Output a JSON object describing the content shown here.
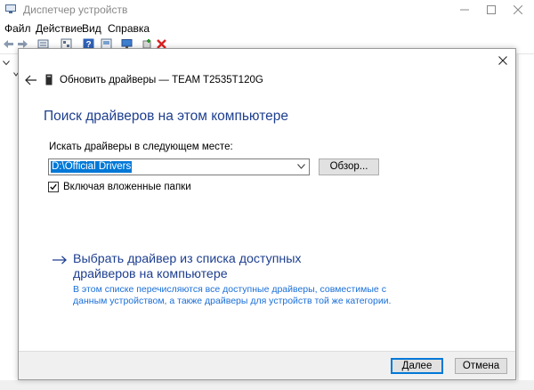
{
  "app": {
    "title": "Диспетчер устройств",
    "menu": [
      "Файл",
      "Действие",
      "Вид",
      "Справка"
    ]
  },
  "dialog": {
    "title": "Обновить драйверы — TEAM T2535T120G",
    "heading": "Поиск драйверов на этом компьютере",
    "search_label": "Искать драйверы в следующем месте:",
    "path_value": "D:\\Official Drivers",
    "browse_label": "Обзор...",
    "include_subfolders_label": "Включая вложенные папки",
    "include_subfolders_checked": true,
    "pick_list_title": "Выбрать драйвер из списка доступных драйверов на компьютере",
    "pick_list_desc": "В этом списке перечисляются все доступные драйверы, совместимые с данным устройством, а также драйверы для устройств той же категории.",
    "next_label": "Далее",
    "cancel_label": "Отмена"
  },
  "colors": {
    "heading_blue": "#1e3f8f",
    "link_desc_blue": "#1a6fd8",
    "selection_blue": "#0078d7"
  }
}
